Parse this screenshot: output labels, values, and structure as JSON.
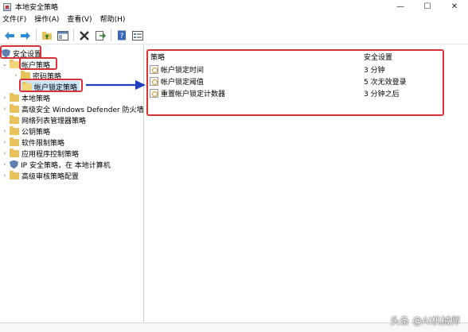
{
  "window": {
    "title": "本地安全策略",
    "controls": {
      "minimize": "—",
      "maximize": "☐",
      "close": "✕"
    }
  },
  "menu": {
    "items": [
      "文件(F)",
      "操作(A)",
      "查看(V)",
      "帮助(H)"
    ]
  },
  "tree": {
    "root": "安全设置",
    "account_policies": "帐户策略",
    "password_policy": "密码策略",
    "lockout_policy": "帐户锁定策略",
    "others": [
      "本地策略",
      "高级安全 Windows Defender 防火墙",
      "网络列表管理器策略",
      "公钥策略",
      "软件限制策略",
      "应用程序控制策略",
      "IP 安全策略，在 本地计算机",
      "高级审核策略配置"
    ]
  },
  "list": {
    "headers": {
      "policy": "策略",
      "setting": "安全设置"
    },
    "rows": [
      {
        "policy": "帐户锁定时间",
        "setting": "3 分钟"
      },
      {
        "policy": "帐户锁定阈值",
        "setting": "5 次无效登录"
      },
      {
        "policy": "重置帐户锁定计数器",
        "setting": "3 分钟之后"
      }
    ]
  },
  "watermark": "头条 @AI机械师",
  "colors": {
    "highlight_red": "#d9313b",
    "arrow_blue": "#1f3fbf",
    "selection": "#cce4f7",
    "folder": "#e8c25b"
  }
}
